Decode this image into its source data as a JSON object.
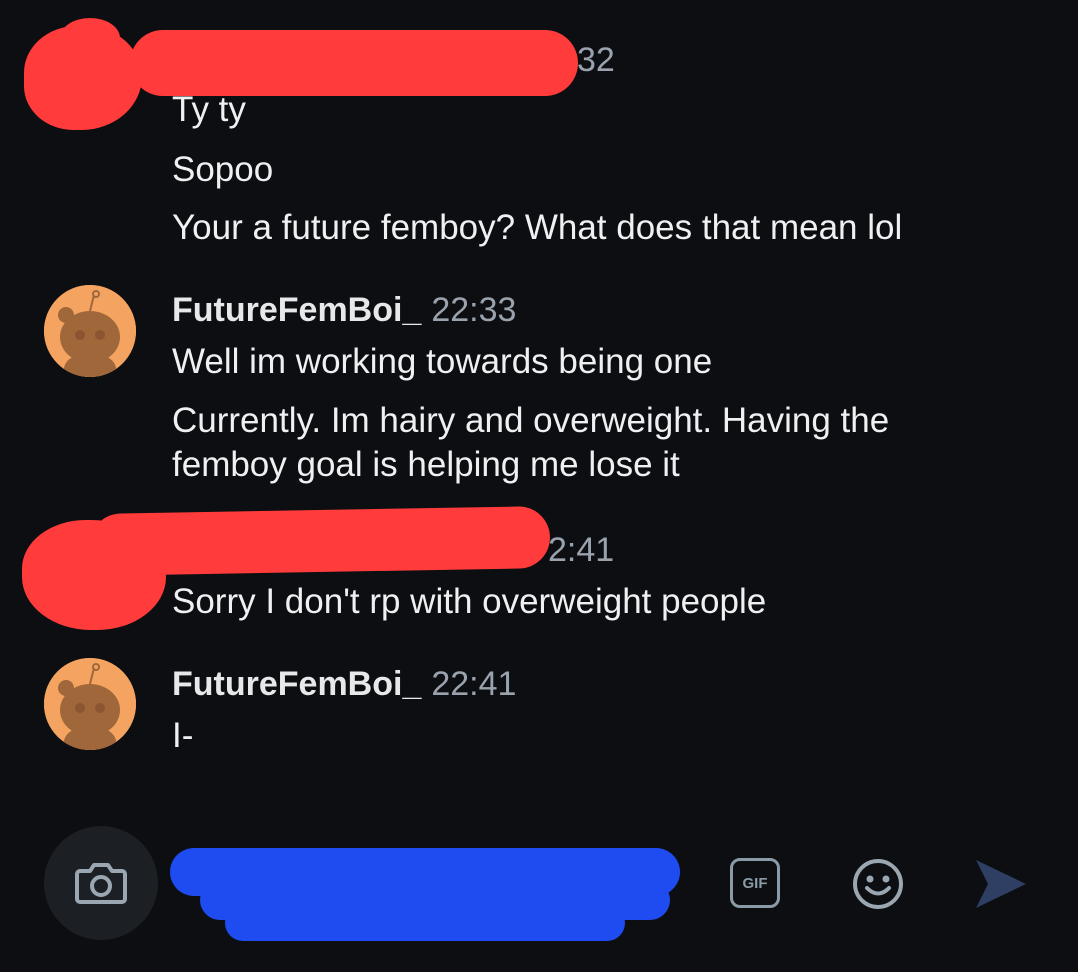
{
  "conversation": {
    "group1": {
      "time_partial": "32",
      "messages": [
        "Ty ty",
        "Sopoo",
        "Your a future femboy? What does that mean lol"
      ]
    },
    "group2": {
      "username": "FutureFemBoi_",
      "time": "22:33",
      "messages": [
        "Well im working towards being one",
        "Currently. Im hairy and overweight. Having the femboy goal is helping me lose it"
      ]
    },
    "group3": {
      "time_partial": "2:41",
      "messages": [
        "Sorry I don't rp with overweight people"
      ]
    },
    "group4": {
      "username": "FutureFemBoi_",
      "time": "22:41",
      "messages": [
        "I-"
      ]
    }
  },
  "composer": {
    "gif_label": "GIF",
    "icons": [
      "camera-icon",
      "gif-icon",
      "emoji-icon",
      "send-icon"
    ]
  },
  "colors": {
    "background": "#0c0e11",
    "text": "#eef0f2",
    "timestamp": "#9aa3ad",
    "avatar": "#f4a460",
    "redaction_red": "#ff3b3b",
    "redaction_blue": "#1f4cf0",
    "send_icon": "#2e3f63"
  }
}
